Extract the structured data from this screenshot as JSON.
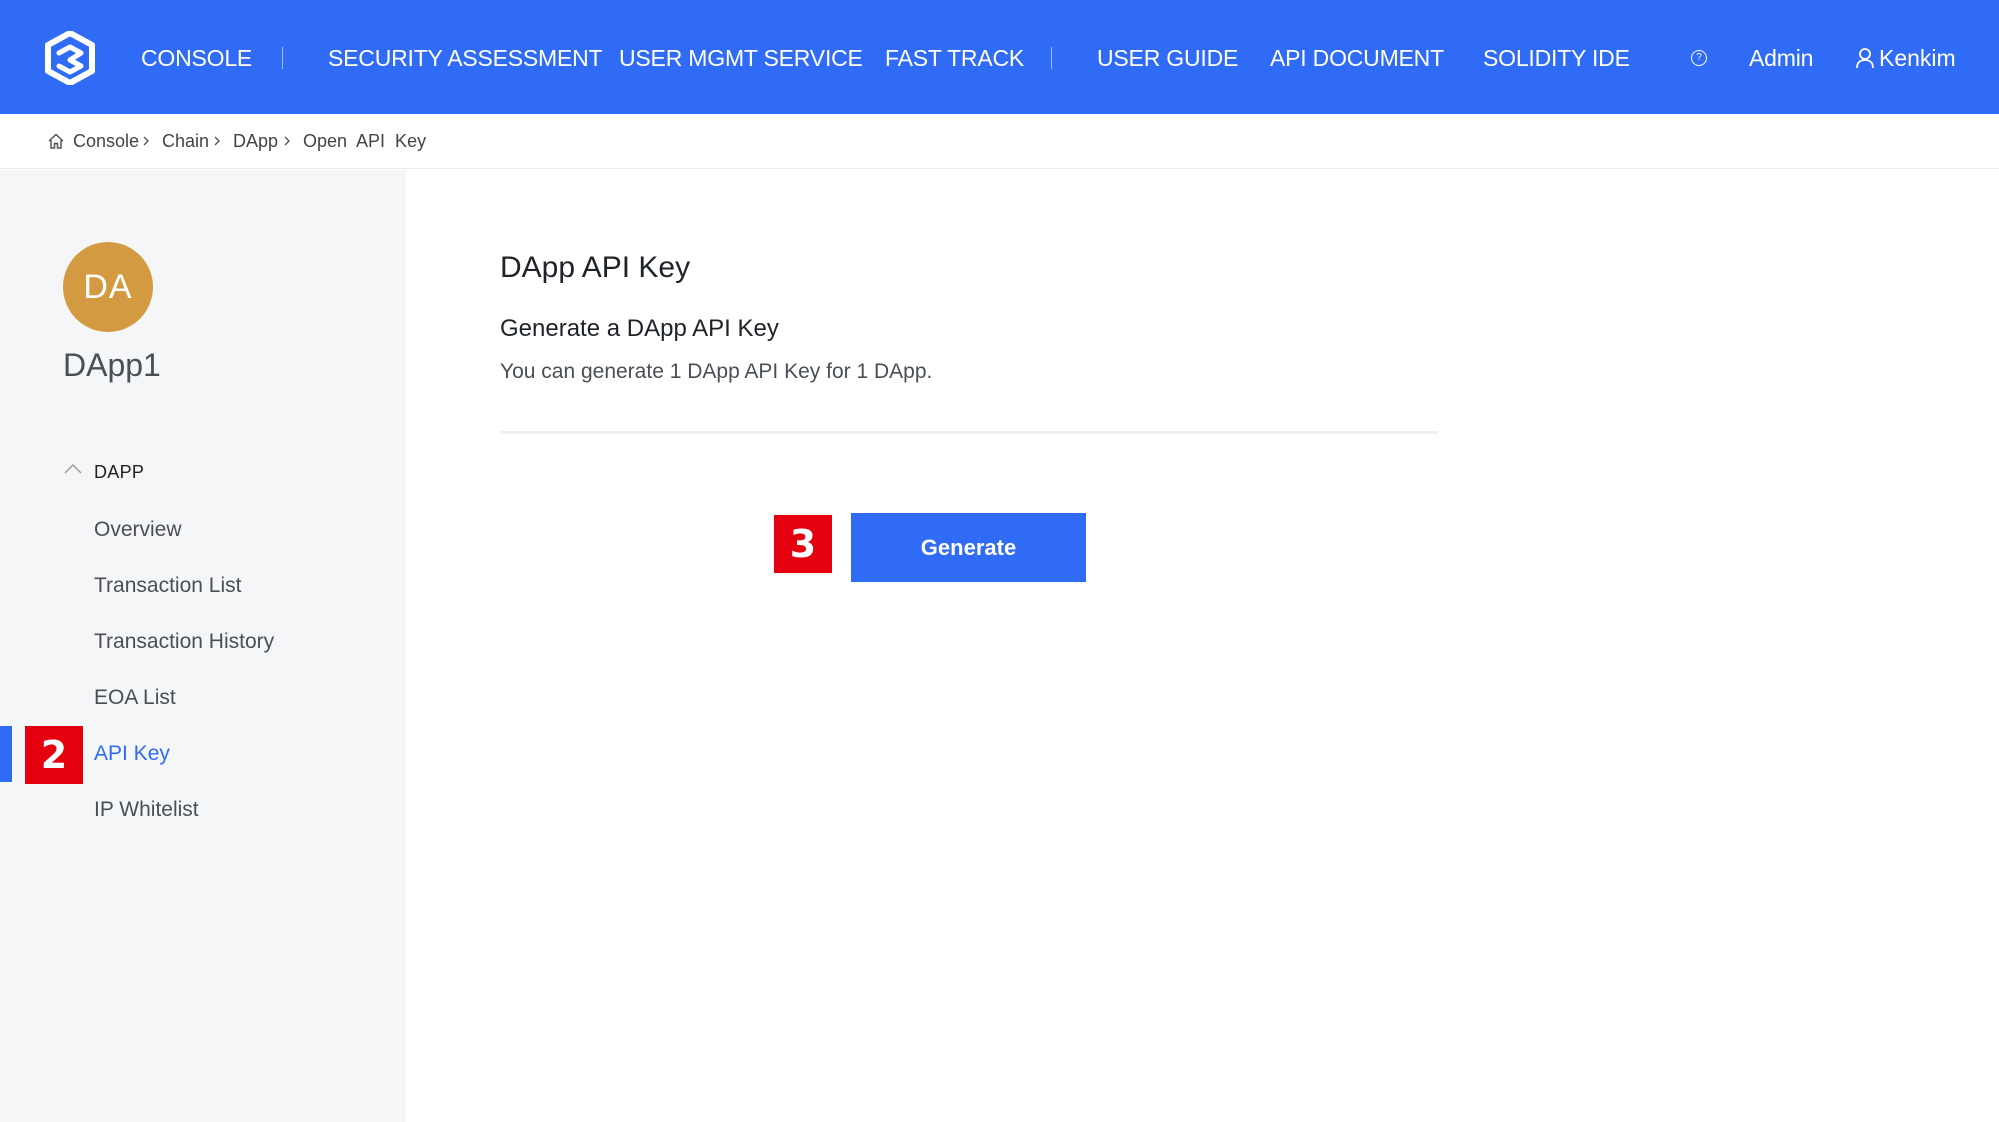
{
  "nav": {
    "items": [
      "CONSOLE",
      "SECURITY ASSESSMENT",
      "USER MGMT SERVICE",
      "FAST TRACK",
      "USER GUIDE",
      "API DOCUMENT",
      "SOLIDITY IDE"
    ],
    "help_icon_glyph": "?",
    "admin_label": "Admin",
    "user_name": "Kenkim",
    "icons": {
      "logo": "logo-icon",
      "help": "help-circle-icon",
      "user": "user-icon"
    }
  },
  "breadcrumb": {
    "items": [
      "Console",
      "Chain",
      "DApp",
      "Open  API  Key"
    ]
  },
  "sidebar": {
    "avatar_initials": "DA",
    "dapp_name": "DApp1",
    "section_label": "DAPP",
    "items": [
      "Overview",
      "Transaction List",
      "Transaction History",
      "EOA List",
      "API Key",
      "IP Whitelist"
    ],
    "active_item": "API Key"
  },
  "main": {
    "title": "DApp API Key",
    "subtitle": "Generate a DApp API Key",
    "description": "You can generate 1 DApp API Key for 1 DApp.",
    "generate_button": "Generate"
  },
  "annotations": {
    "step_sidebar": "2",
    "step_button": "3"
  },
  "colors": {
    "primary": "#2f6bf5",
    "avatar": "#d49a41",
    "annotation": "#e5000f",
    "sidebar_bg": "#f5f6f8"
  }
}
